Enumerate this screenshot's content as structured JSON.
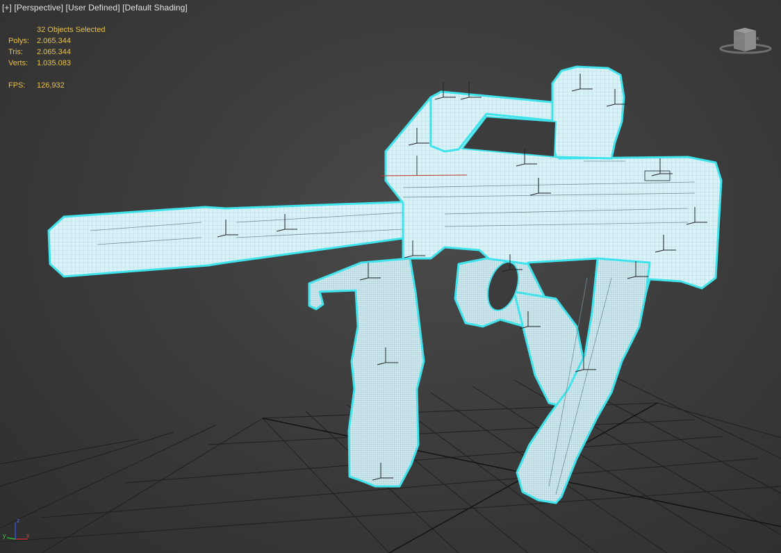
{
  "viewport": {
    "label_plus": "[+]",
    "label_view": "[Perspective]",
    "label_camera": "[User Defined]",
    "label_shading": "[Default Shading]"
  },
  "stats": {
    "selection": "32 Objects Selected",
    "polys_label": "Polys:",
    "polys_value": "2.065.344",
    "tris_label": "Tris:",
    "tris_value": "2.065.344",
    "verts_label": "Verts:",
    "verts_value": "1.035.083",
    "fps_label": "FPS:",
    "fps_value": "126,932"
  },
  "viewcube": {
    "left_face": "LEFT",
    "back_face": "BACK"
  },
  "axis_tripod": {
    "x": "x",
    "y": "y",
    "z": "z"
  },
  "colors": {
    "background": "#3c3c3c",
    "grid": "#1e1e1e",
    "model_fill": "#d8f2f8",
    "selection_outline": "#3fe3ec",
    "stats_text": "#e8c24a",
    "label_text": "#e4e4e4"
  }
}
